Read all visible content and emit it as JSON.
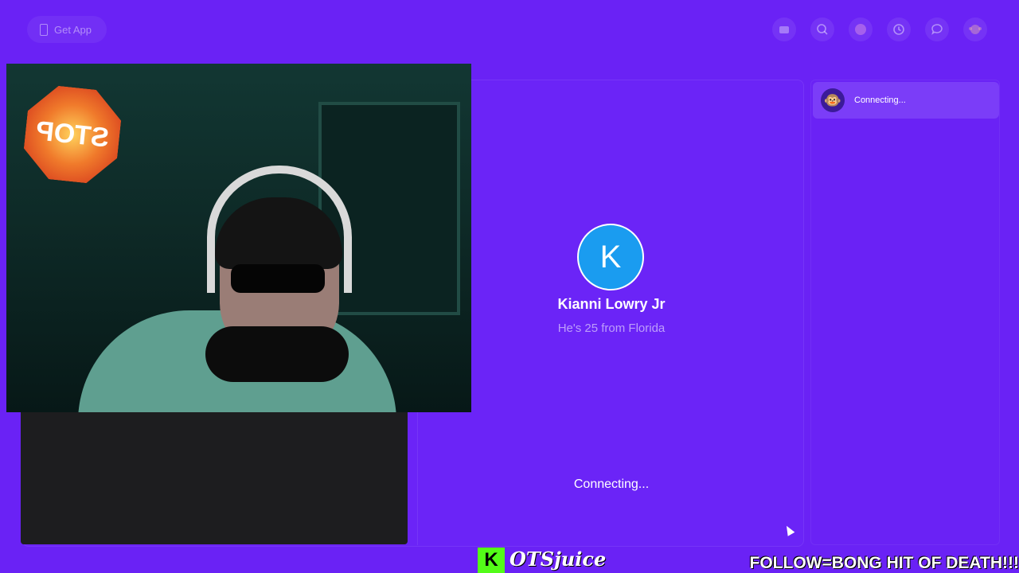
{
  "topbar": {
    "get_app_label": "Get App",
    "nav_icons": [
      "ticket-icon",
      "search-icon",
      "profile-icon",
      "history-icon",
      "chat-icon",
      "monkey-icon"
    ]
  },
  "stage": {
    "avatar_letter": "K",
    "peer_name": "Kianni Lowry Jr",
    "peer_subtitle": "He's 25 from Florida",
    "status": "Connecting..."
  },
  "chat": {
    "avatar_emoji": "🐵",
    "status": "Connecting..."
  },
  "overlay": {
    "stop_sign_text": "STOP",
    "kick_logo_letter": "K",
    "streamer_name": "OTSjuice",
    "follow_text": "FOLLOW=BONG HIT OF DEATH!!!"
  },
  "colors": {
    "background": "#6a22f5",
    "avatar_blue": "#1a9cf0",
    "kick_green": "#53fc18"
  }
}
